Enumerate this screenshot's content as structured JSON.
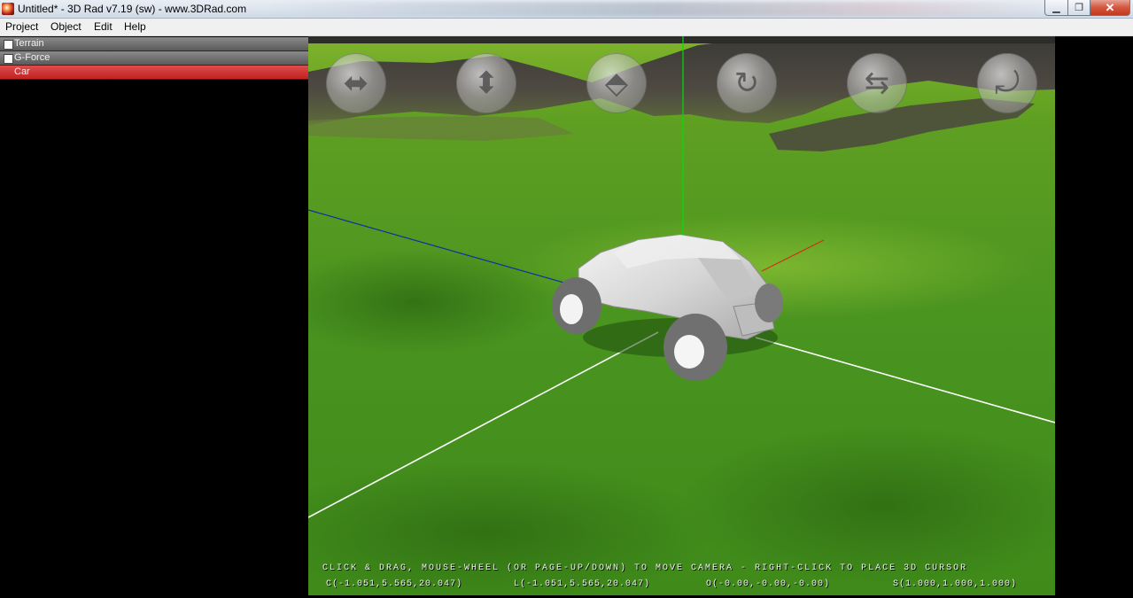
{
  "window": {
    "title": "Untitled* - 3D Rad v7.19 (sw) - www.3DRad.com",
    "minimize_glyph": "▁",
    "maximize_glyph": "❐",
    "close_glyph": "✕"
  },
  "menu": {
    "items": [
      "Project",
      "Object",
      "Edit",
      "Help"
    ]
  },
  "objects": [
    {
      "label": "Terrain",
      "checked": false,
      "selected": false
    },
    {
      "label": "G-Force",
      "checked": false,
      "selected": false
    },
    {
      "label": "Car",
      "selected": true
    }
  ],
  "viewport": {
    "nav_buttons": [
      {
        "name": "pan-horizontal",
        "glyph": "⬌"
      },
      {
        "name": "pan-vertical",
        "glyph": "⬍"
      },
      {
        "name": "move-forward",
        "glyph": "⬘"
      },
      {
        "name": "rotate-vertical",
        "glyph": "↻"
      },
      {
        "name": "rotate-horizontal",
        "glyph": "⇆"
      },
      {
        "name": "roll",
        "glyph": "⤾"
      }
    ],
    "hint": "CLICK & DRAG, MOUSE-WHEEL (OR PAGE-UP/DOWN) TO MOVE CAMERA - RIGHT-CLICK TO PLACE 3D CURSOR",
    "coord_c": "C(-1.051,5.565,20.047)",
    "coord_l": "L(-1.051,5.565,20.047)",
    "coord_o": "O(-0.00,-0.00,-0.00)",
    "coord_s": "S(1.000,1.000,1.000)"
  },
  "colors": {
    "selection": "#c02222",
    "grass": "#4f9a1e",
    "axis_y": "#00e000",
    "axis_x": "#d03010",
    "axis_z": "#1030a0"
  }
}
